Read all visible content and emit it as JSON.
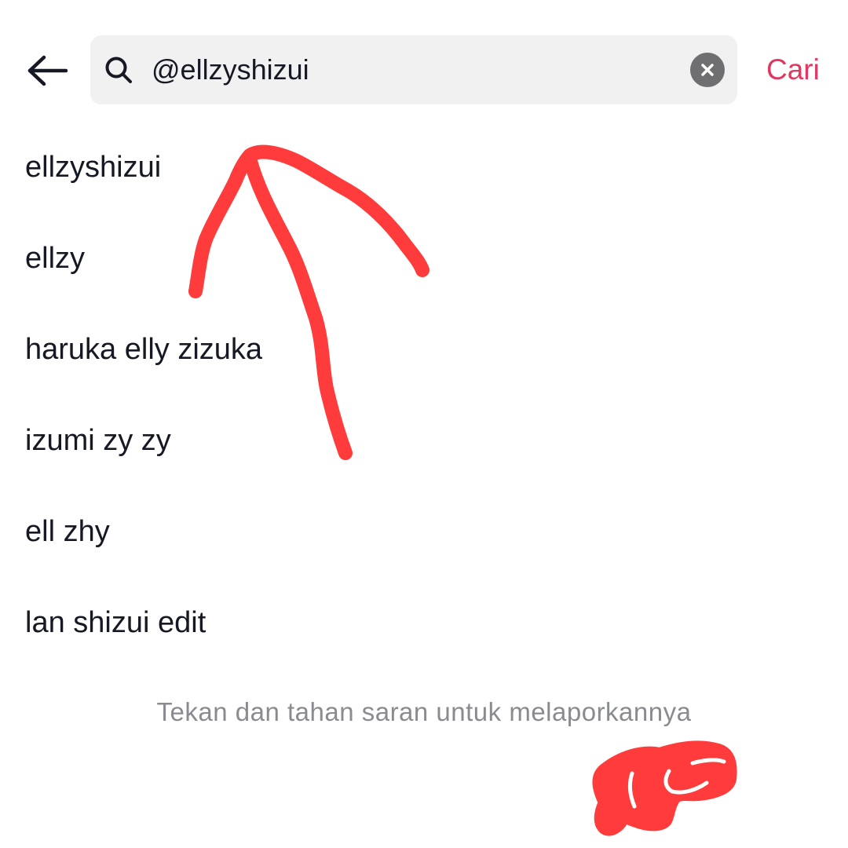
{
  "header": {
    "back_icon": "arrow-left-icon",
    "search": {
      "icon": "search-icon",
      "value": "@ellzyshizui",
      "clear_icon": "close-icon"
    },
    "submit_label": "Cari"
  },
  "suggestions": [
    "ellzyshizui",
    "ellzy",
    "haruka elly zizuka",
    "izumi zy zy",
    "ell zhy",
    "lan shizui edit"
  ],
  "hint": "Tekan dan tahan saran untuk melaporkannya",
  "colors": {
    "accent": "#e0385f",
    "annotation": "#ff3b3b",
    "search_bg": "#f1f1f2",
    "hint_text": "#8a8b91"
  }
}
